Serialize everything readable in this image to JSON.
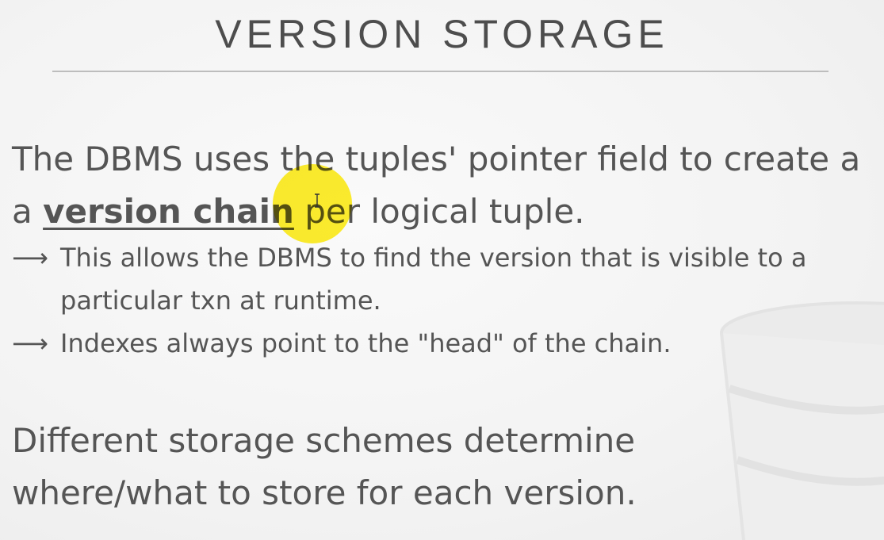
{
  "slide": {
    "title": "VERSION STORAGE",
    "paragraph1": {
      "before": "The DBMS uses the tuples' pointer field to create a ",
      "term": "version chain",
      "after": " per logical tuple."
    },
    "bullets": [
      {
        "arrow": "⟶",
        "text": "This allows the DBMS to find the version that is visible to a particular txn at runtime."
      },
      {
        "arrow": "⟶",
        "text": "Indexes always point to the \"head\" of the chain."
      }
    ],
    "paragraph2": "Different storage schemes determine where/what to store for each version.",
    "colors": {
      "background": "#f6f6f6",
      "text": "#555555",
      "cursor_highlight": "#ffeb00"
    },
    "icons": [
      "database-watermark-icon",
      "text-cursor-icon"
    ]
  }
}
